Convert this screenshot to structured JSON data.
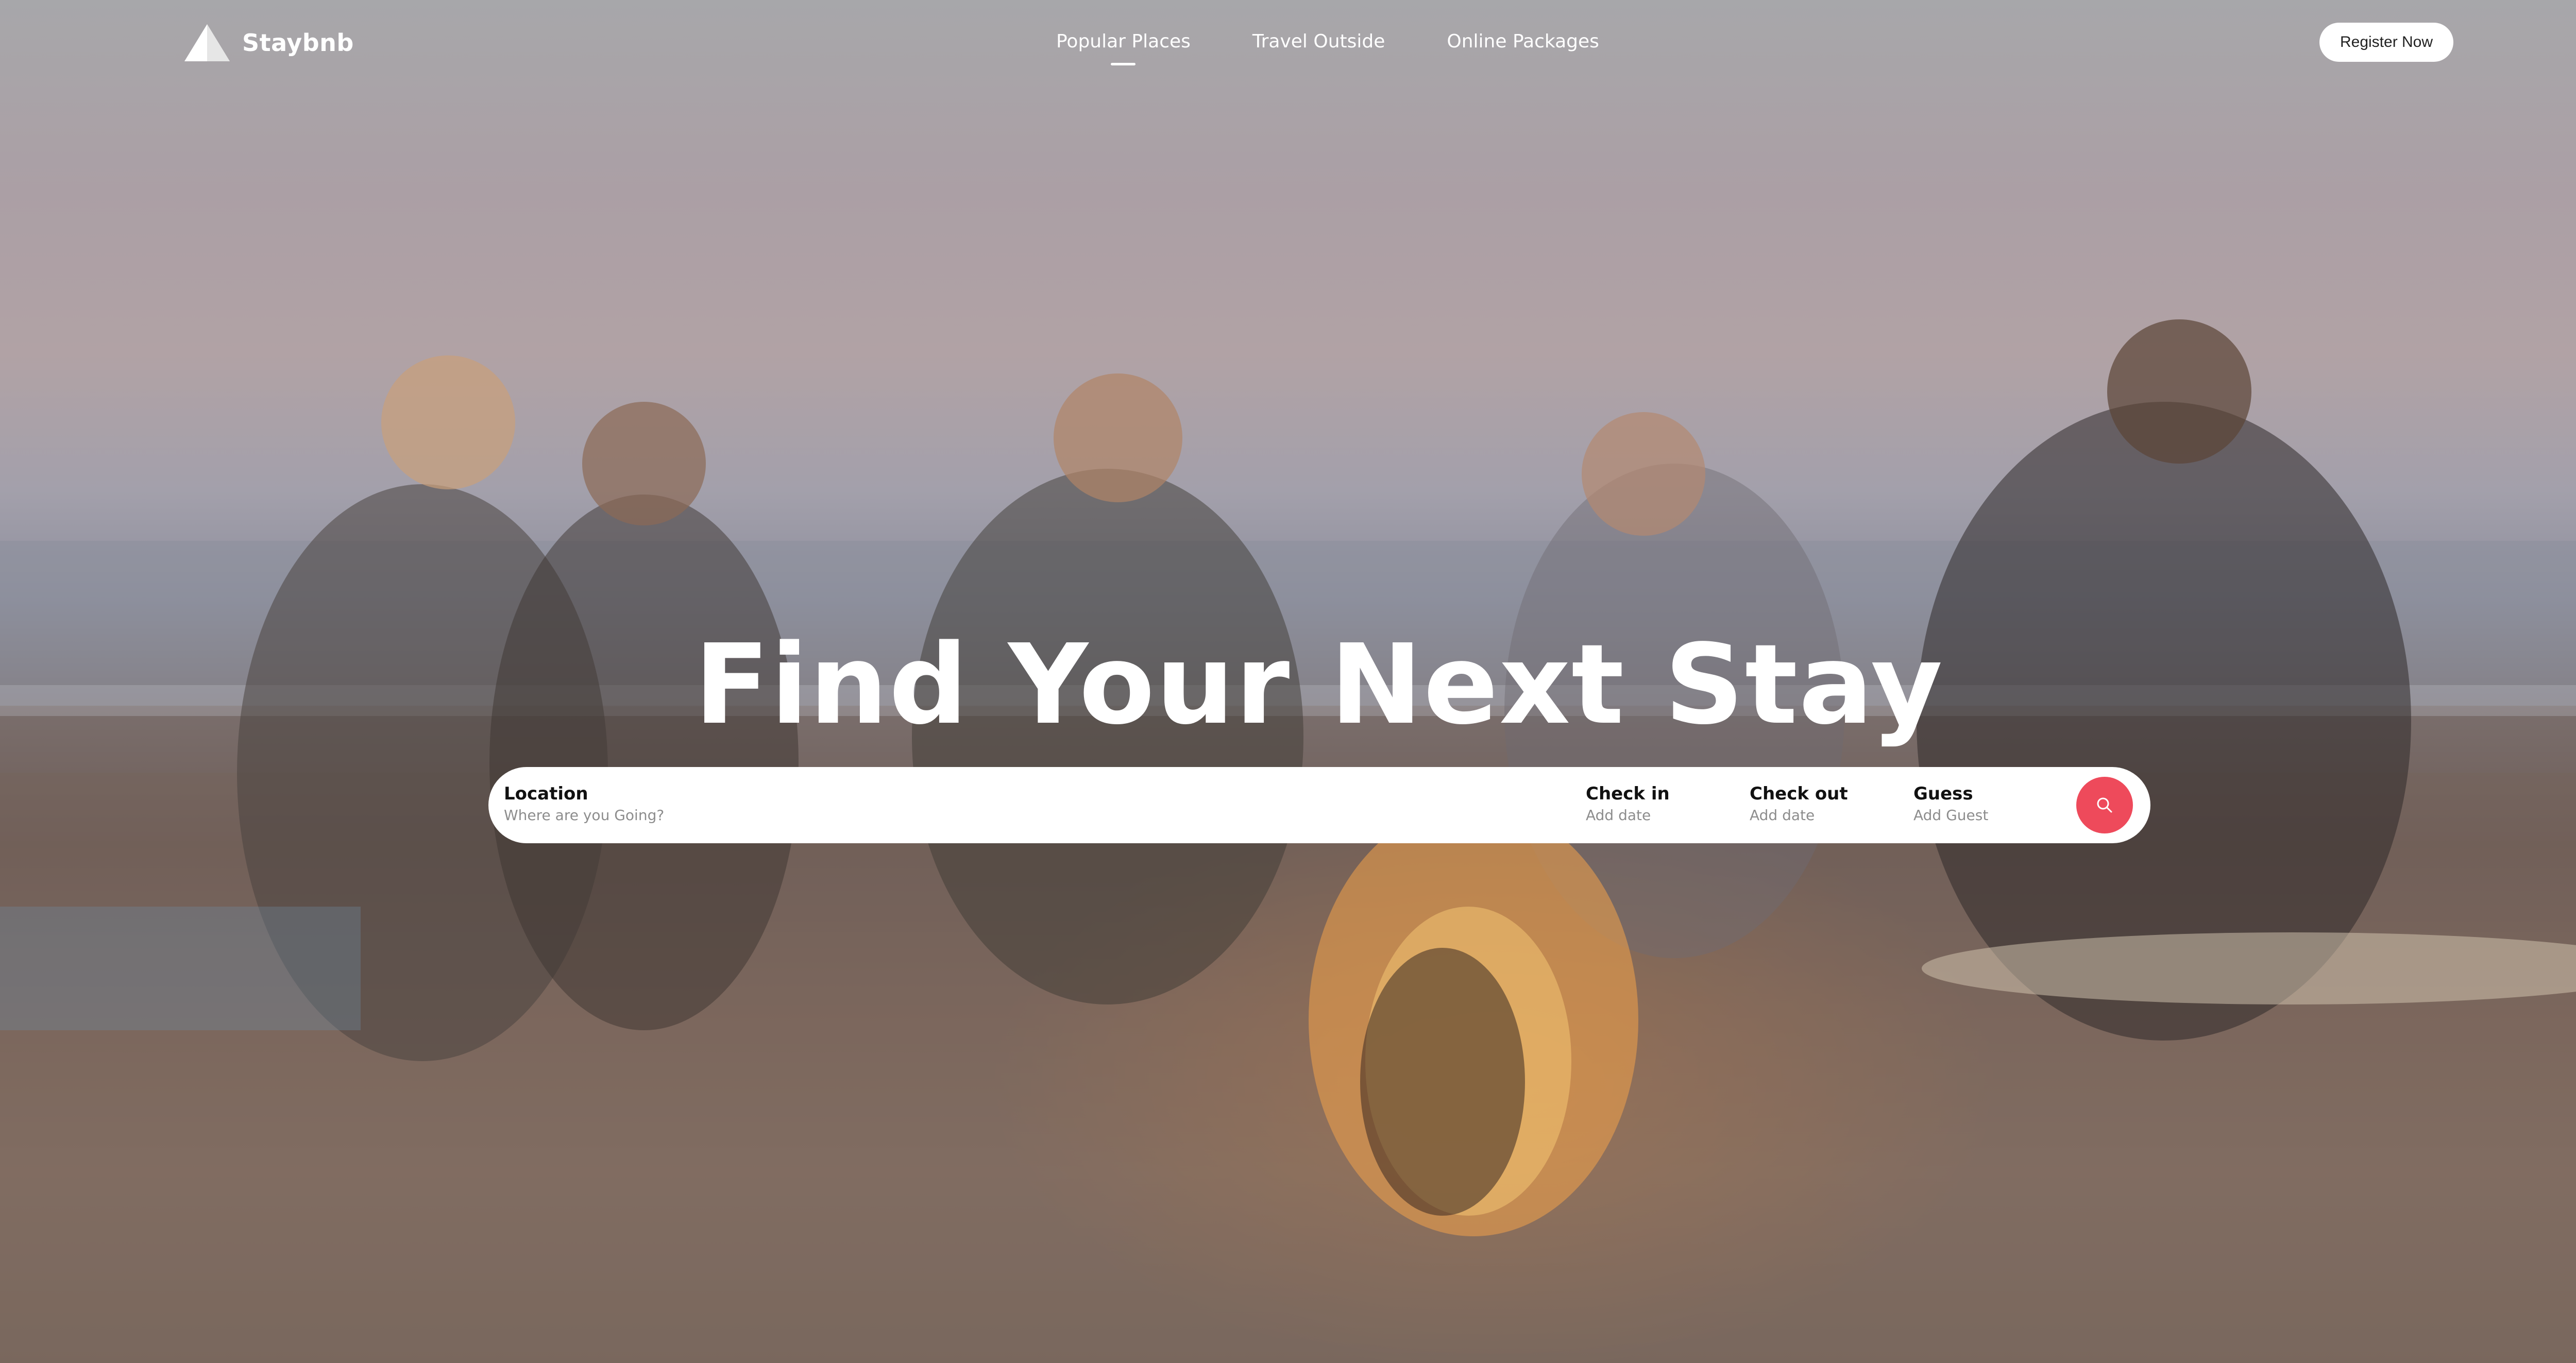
{
  "brand": {
    "name": "Staybnb",
    "icon": "triangle-logo-icon"
  },
  "nav": {
    "items": [
      {
        "label": "Popular Places",
        "active": true
      },
      {
        "label": "Travel Outside",
        "active": false
      },
      {
        "label": "Online Packages",
        "active": false
      }
    ]
  },
  "header": {
    "register_label": "Register Now"
  },
  "hero": {
    "headline": "Find Your Next Stay",
    "background_description_icon": "beach-bonfire-photo"
  },
  "search": {
    "location": {
      "label": "Location",
      "placeholder": "Where are you Going?"
    },
    "check_in": {
      "label": "Check in",
      "placeholder": "Add date"
    },
    "check_out": {
      "label": "Check out",
      "placeholder": "Add date"
    },
    "guests": {
      "label": "Guess",
      "placeholder": "Add Guest"
    },
    "button_icon": "search-icon"
  },
  "colors": {
    "accent": "#ee4a5b",
    "text_on_hero": "#ffffff"
  }
}
